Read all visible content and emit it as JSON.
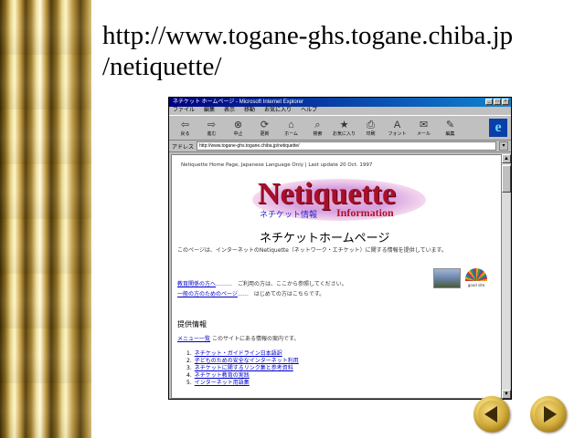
{
  "slide": {
    "title_line1": "http://www.togane-ghs.togane.chiba.jp",
    "title_line2": "/netiquette/"
  },
  "browser": {
    "window_title": "ネチケット ホームページ - Microsoft Internet Explorer",
    "menu": [
      "ファイル",
      "編集",
      "表示",
      "移動",
      "お気に入り",
      "ヘルプ"
    ],
    "toolbar": [
      {
        "icon": "back-arrow-icon",
        "glyph": "⇦",
        "label": "戻る"
      },
      {
        "icon": "forward-arrow-icon",
        "glyph": "⇨",
        "label": "進む"
      },
      {
        "icon": "stop-icon",
        "glyph": "⊗",
        "label": "中止"
      },
      {
        "icon": "refresh-icon",
        "glyph": "⟳",
        "label": "更新"
      },
      {
        "icon": "home-icon",
        "glyph": "⌂",
        "label": "ホーム"
      },
      {
        "icon": "search-icon",
        "glyph": "⌕",
        "label": "検索"
      },
      {
        "icon": "favorites-icon",
        "glyph": "★",
        "label": "お気に入り"
      },
      {
        "icon": "print-icon",
        "glyph": "⎙",
        "label": "印刷"
      },
      {
        "icon": "font-icon",
        "glyph": "A",
        "label": "フォント"
      },
      {
        "icon": "mail-icon",
        "glyph": "✉",
        "label": "メール"
      },
      {
        "icon": "edit-icon",
        "glyph": "✎",
        "label": "編集"
      }
    ],
    "address_label": "アドレス",
    "address_value": "http://www.togane-ghs.togane.chiba.jp/netiquette/"
  },
  "page": {
    "header_text": "Netiquette Home Page, Japanese Language Only | Last update 20 Oct. 1997",
    "banner_title": "Netiquette",
    "banner_jp": "ネチケット情報",
    "banner_info": "Information",
    "heading": "ネチケットホームページ",
    "intro": "このページは、インターネットのNetiquette（ネットワーク・エチケット）に関する情報を提供しています。",
    "links": [
      {
        "text": "教育関係の方へ",
        "desc": "………　ご利用の方は、ここから参照してください。"
      },
      {
        "text": "一般の方のためのページ",
        "desc": "……　はじめての方はこちらです。"
      }
    ],
    "badge_caption": "good site",
    "section_heading": "提供情報",
    "section_link": "メニュー一覧",
    "section_desc": "このサイトにある情報の案内です。",
    "list": [
      {
        "num": "1.",
        "text": "ネチケット・ガイドライン日本語訳"
      },
      {
        "num": "2.",
        "text": "子どものための安全なインターネット利用"
      },
      {
        "num": "3.",
        "text": "ネチケットに関するリンク集と参考資料"
      },
      {
        "num": "4.",
        "text": "ネチケット教育の実践"
      },
      {
        "num": "5.",
        "text": "インターネット用語集"
      }
    ]
  },
  "nav": {
    "prev_icon": "previous-slide-icon",
    "next_icon": "next-slide-icon"
  }
}
